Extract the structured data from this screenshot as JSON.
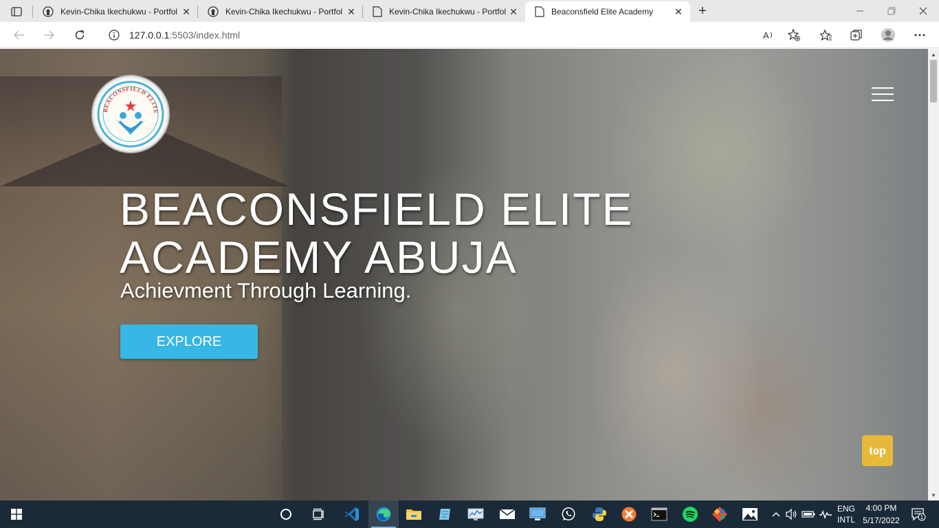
{
  "browser": {
    "tabs": [
      {
        "title": "Kevin-Chika Ikechukwu - Portfolio",
        "active": false
      },
      {
        "title": "Kevin-Chika Ikechukwu - Portfolio",
        "active": false
      },
      {
        "title": "Kevin-Chika Ikechukwu - Portfolio",
        "active": false
      },
      {
        "title": "Beaconsfield Elite Academy",
        "active": true
      }
    ],
    "address": {
      "host": "127.0.0.1",
      "rest": ":5503/index.html"
    }
  },
  "page": {
    "logo_text": "BEACONSFIELD ELITE ACADEMY",
    "title_line1": "BEACONSFIELD ELITE",
    "title_line2": "ACADEMY ABUJA",
    "subtitle": "Achievment Through Learning.",
    "explore_label": "EXPLORE",
    "top_label": "top"
  },
  "taskbar": {
    "language": "ENG",
    "layout": "INTL",
    "time": "4:00 PM",
    "date": "5/17/2022",
    "notification_count": "1"
  },
  "colors": {
    "accent": "#36b7e5",
    "top_button": "#e6b93a",
    "taskbar": "#1b2a38"
  }
}
